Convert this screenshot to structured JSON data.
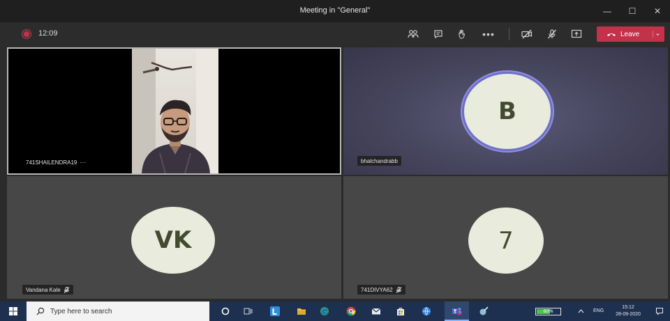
{
  "window": {
    "title": "Meeting in \"General\"",
    "minimize_glyph": "—",
    "maximize_glyph": "☐",
    "close_glyph": "✕"
  },
  "toolbar": {
    "recording_color": "#c4314b",
    "timer": "12:09",
    "buttons": [
      "people-icon",
      "chat-icon",
      "raise-hand-icon",
      "more-options-icon",
      "camera-off-icon",
      "mic-off-icon",
      "share-screen-icon"
    ],
    "leave_label": "Leave",
    "leave_color": "#c4314b"
  },
  "tiles": [
    {
      "name": "741SHAILENDRA19",
      "more": "···",
      "type": "video"
    },
    {
      "name": "bhalchandrabb",
      "initials": "B",
      "type": "avatar",
      "highlight": true
    },
    {
      "name": "Vandana Kale",
      "initials": "VK",
      "type": "avatar",
      "muted": true
    },
    {
      "name": "741DIVYA62",
      "initials": "7",
      "type": "avatar",
      "muted": true
    }
  ],
  "taskbar": {
    "search_placeholder": "Type here to search",
    "battery_level": 0.6,
    "battery_label": "60%",
    "language": "ENG",
    "time": "15:12",
    "date": "28-09-2020",
    "background": "#1e3050"
  }
}
